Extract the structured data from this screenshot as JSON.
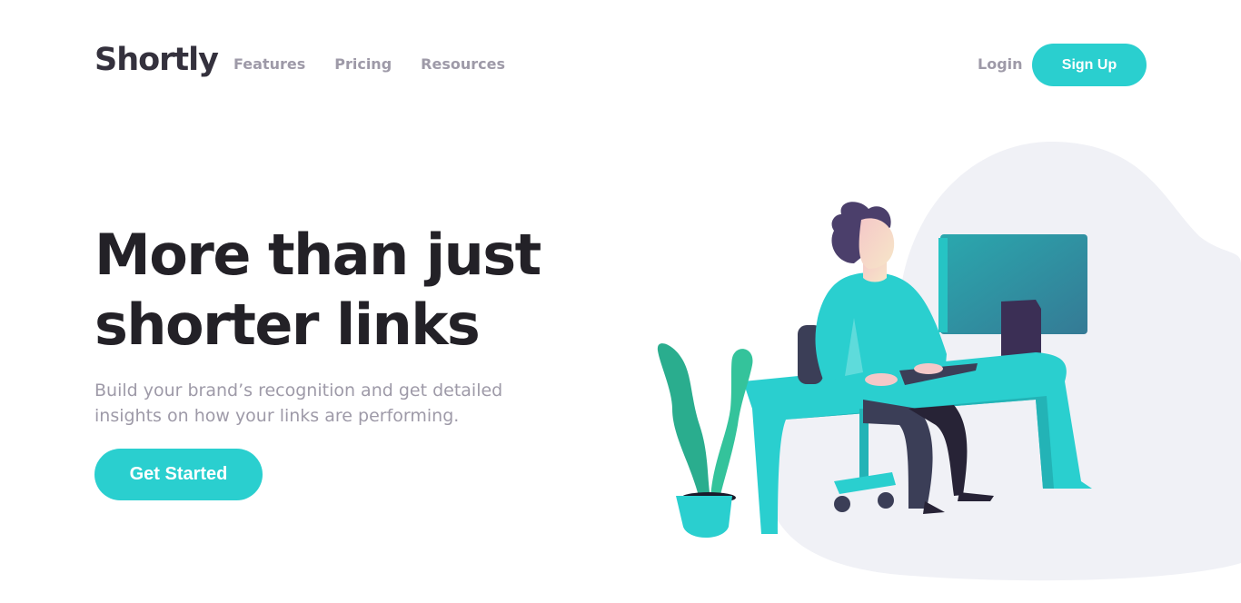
{
  "header": {
    "logo": "Shortly",
    "nav": [
      "Features",
      "Pricing",
      "Resources"
    ],
    "login": "Login",
    "signup": "Sign Up"
  },
  "hero": {
    "title": "More than just shorter links",
    "subtitle": "Build your brand’s recognition and get detailed insights on how your links are performing.",
    "cta": "Get Started"
  },
  "colors": {
    "primary": "#2acfcf",
    "dark": "#232127",
    "gray": "#9e9aa8",
    "blob": "#f0f1f6"
  }
}
